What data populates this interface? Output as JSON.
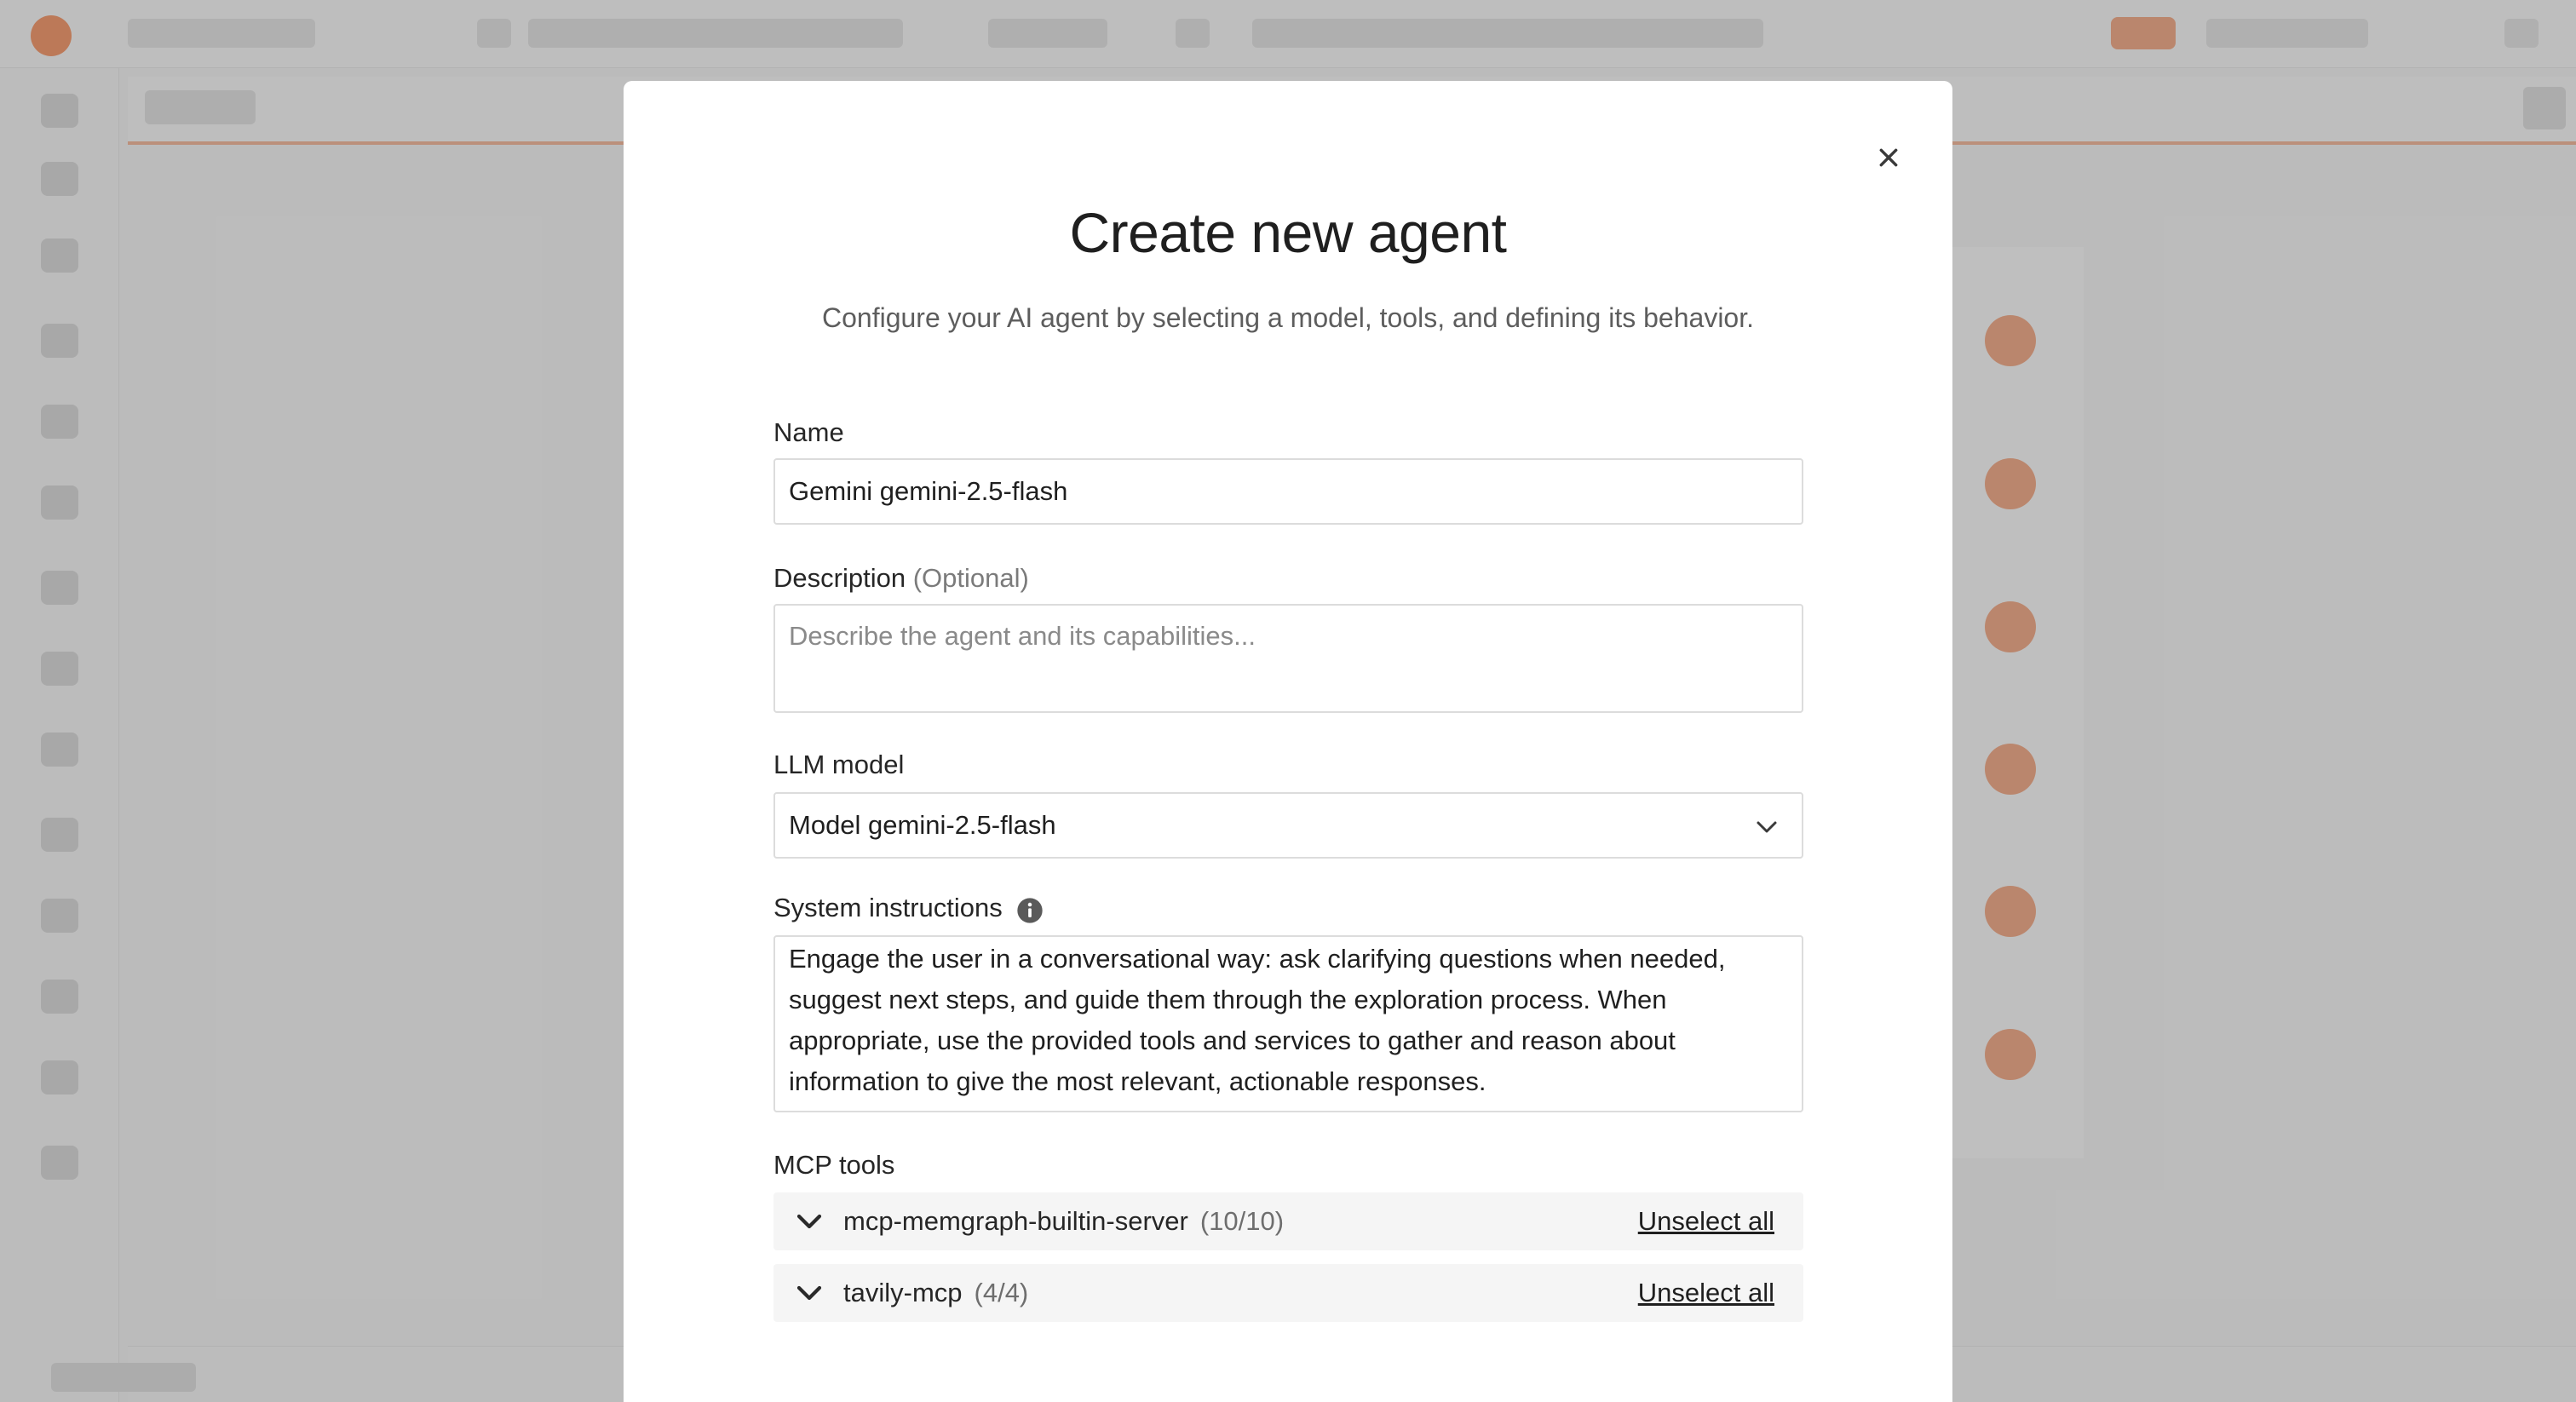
{
  "modal": {
    "title": "Create new agent",
    "subtitle": "Configure your AI agent by selecting a model, tools, and defining its behavior.",
    "close_icon": "close-icon"
  },
  "form": {
    "name": {
      "label": "Name",
      "value": "Gemini gemini-2.5-flash"
    },
    "description": {
      "label": "Description",
      "optional_label": "(Optional)",
      "placeholder": "Describe the agent and its capabilities..."
    },
    "llm_model": {
      "label": "LLM model",
      "selected": "Model gemini-2.5-flash",
      "icon": "chevron-down-icon"
    },
    "system_instructions": {
      "label": "System instructions",
      "info_icon": "info-icon",
      "value": "Engage the user in a conversational way: ask clarifying questions when needed, suggest next steps, and guide them through the exploration process. When appropriate, use the provided tools and services to gather and reason about information to give the most relevant, actionable responses."
    },
    "mcp_tools": {
      "label": "MCP tools",
      "servers": [
        {
          "name": "mcp-memgraph-builtin-server",
          "count": "(10/10)",
          "action": "Unselect all"
        },
        {
          "name": "tavily-mcp",
          "count": "(4/4)",
          "action": "Unselect all"
        }
      ]
    }
  },
  "colors": {
    "accent": "#f47b3f",
    "overlay": "#787878",
    "modal_bg": "#ffffff",
    "border": "#dcdcdc"
  }
}
